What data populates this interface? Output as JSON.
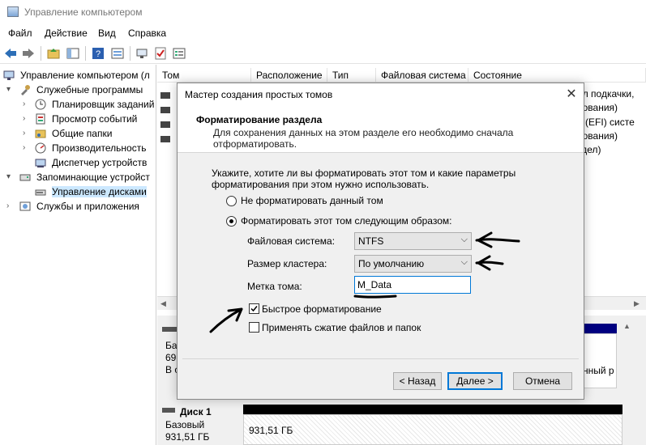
{
  "window": {
    "title": "Управление компьютером"
  },
  "menu": [
    "Файл",
    "Действие",
    "Вид",
    "Справка"
  ],
  "tree": {
    "root": "Управление компьютером (л",
    "service": "Служебные программы",
    "service_items": [
      "Планировщик заданий",
      "Просмотр событий",
      "Общие папки",
      "Производительность",
      "Диспетчер устройств"
    ],
    "storage": "Запоминающие устройст",
    "disk_mgmt": "Управление дисками",
    "services_apps": "Службы и приложения"
  },
  "list": {
    "columns": [
      "Том",
      "Расположение",
      "Тип",
      "Файловая система",
      "Состояние"
    ],
    "right_texts": [
      "йл подкачки,",
      "нования)",
      "й (EFI) систе",
      "нования)",
      "здел)"
    ]
  },
  "disks": {
    "disk0_partial": [
      "Баз",
      "698",
      "В с"
    ],
    "disk0_right": "нный р",
    "disk1_name": "Диск 1",
    "disk1_type": "Базовый",
    "disk1_size": "931,51 ГБ",
    "disk1_part_size": "931,51 ГБ"
  },
  "dialog": {
    "title": "Мастер создания простых томов",
    "header_title": "Форматирование раздела",
    "header_desc": "Для сохранения данных на этом разделе его необходимо сначала отформатировать.",
    "prompt": "Укажите, хотите ли вы форматировать этот том и какие параметры форматирования при этом нужно использовать.",
    "option_no_format": "Не форматировать данный том",
    "option_format": "Форматировать этот том следующим образом:",
    "fs_label": "Файловая система:",
    "fs_value": "NTFS",
    "cluster_label": "Размер кластера:",
    "cluster_value": "По умолчанию",
    "volume_label_label": "Метка тома:",
    "volume_label_value": "M_Data",
    "quick_format": "Быстрое форматирование",
    "compression": "Применять сжатие файлов и папок",
    "btn_back": "< Назад",
    "btn_next": "Далее >",
    "btn_cancel": "Отмена",
    "quick_format_checked": true,
    "compression_checked": false,
    "selected_option": "format"
  },
  "colors": {
    "accent": "#0078d7",
    "selection": "#cce8ff",
    "disk_bar": "#000080"
  }
}
